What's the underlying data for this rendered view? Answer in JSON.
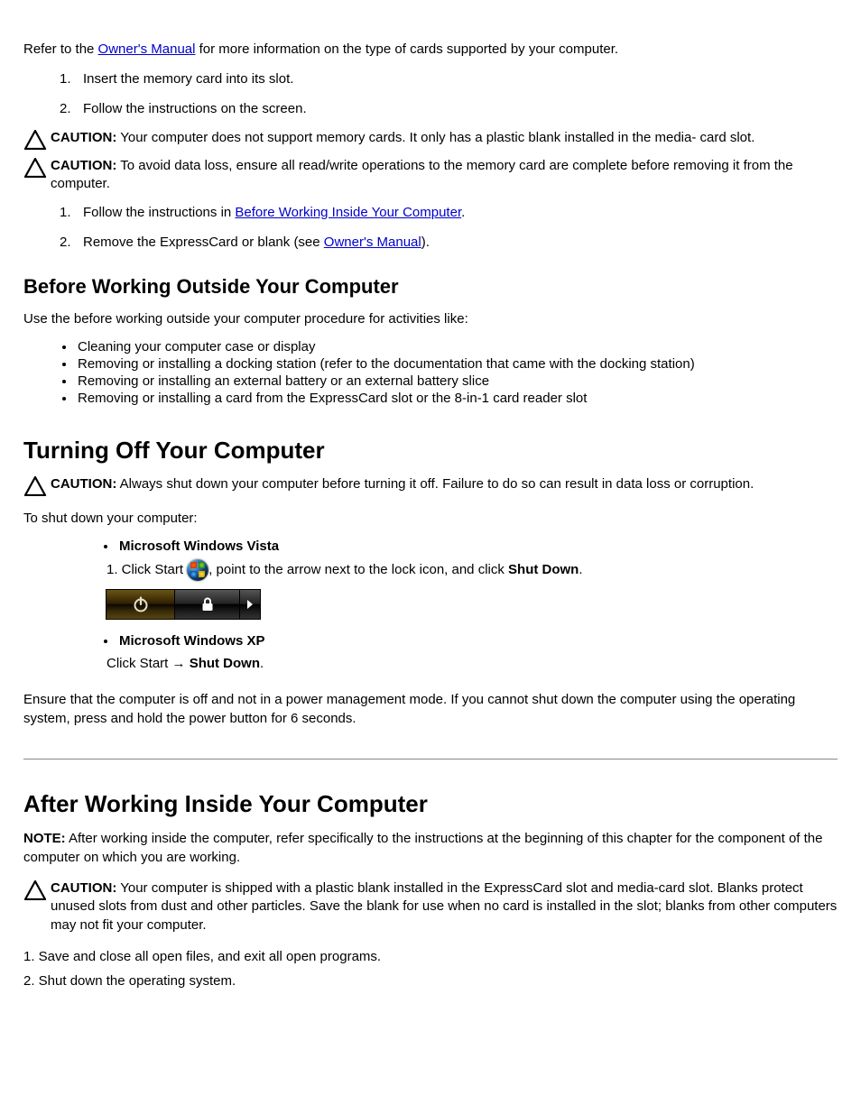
{
  "top": {
    "intro_prefix": "Refer to the ",
    "intro_link": "Owner's Manual",
    "intro_suffix": " for more information on the type of cards supported by your computer."
  },
  "cautions": {
    "c1_label": "CAUTION:",
    "c1_text": " Your computer does not support memory cards. It only has a plastic blank installed in the media- card slot.",
    "c2_label": "CAUTION:",
    "c2_text": " To avoid data loss, ensure all read/write operations to the memory card are complete before removing it from the computer.",
    "c3_label": "CAUTION:",
    "c3_text": " Always shut down your computer before turning it off. Failure to do so can result in data loss or corruption.",
    "c4_label": "CAUTION:",
    "c4_text": " Your computer is shipped with a plastic blank installed in the ExpressCard slot and media-card slot. Blanks protect unused slots from dust and other particles. Save the blank for use when no card is installed in the slot; blanks from other computers may not fit your computer."
  },
  "steps": {
    "s1_num": "1.",
    "s1_text": "Insert the memory card into its slot.",
    "s2_num": "2.",
    "s2_text": "Follow the instructions on the screen.",
    "s3_a": "1. Click Start ",
    "s3_b": ", point to the arrow next to the lock icon, and click ",
    "s3_bold": "Shut Down",
    "s3_c": ".",
    "s4_a": "Click Start ",
    "s4_b": "→ ",
    "s4_bold": "Shut Down",
    "s4_c": ".",
    "s5_num": "1.",
    "s5_text_a": "Follow the instructions in ",
    "s5_link": "Before Working Inside Your Computer",
    "s5_text_b": ".",
    "s6_num": "2.",
    "s6_text_a": "Remove the ExpressCard or blank (see ",
    "s6_link": "Owner's Manual",
    "s6_text_b": ")."
  },
  "headings": {
    "h_off": "Turning Off Your Computer",
    "h_after": "After Working Inside Your Computer",
    "h_before_outside": "Before Working Outside Your Computer",
    "h_vista": "Microsoft Windows Vista",
    "h_xp": "Microsoft Windows XP"
  },
  "body": {
    "activities": "Use the before working outside your computer procedure for activities like:",
    "act1": "Cleaning your computer case or display",
    "act2": "Removing or installing a docking station (refer to the documentation that came with the docking station)",
    "act3": "Removing or installing an external battery or an external battery slice",
    "act4": "Removing or installing a card from the ExpressCard slot or the 8-in-1 card reader slot",
    "shutdown_intro": "To shut down your computer:",
    "save_close": "1. Save and close all open files, and exit all open programs.",
    "shutdown_os": "2. Shut down the operating system.",
    "note_label": "NOTE:",
    "note_text": " After working inside the computer, refer specifically to the instructions at the beginning of this chapter for the component of the computer on which you are working.",
    "ensure_off": "Ensure that the computer is off and not in a power management mode. If you cannot shut down the computer using the operating system, press and hold the power button for 6 seconds."
  }
}
